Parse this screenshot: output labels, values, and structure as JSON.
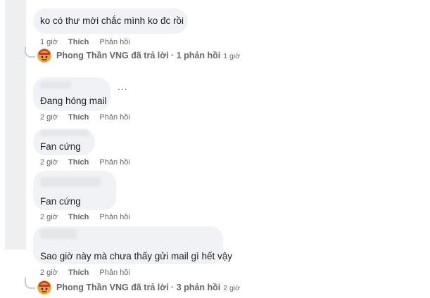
{
  "comments": [
    {
      "text": "ko có thư mời chắc mình ko đc rồi",
      "time": "1 giờ",
      "like": "Thích",
      "reply": "Phản hồi"
    },
    {
      "text": "Đang hóng mail",
      "time": "2 giờ",
      "like": "Thích",
      "reply": "Phản hồi",
      "more": "..."
    },
    {
      "text": "Fan cứng",
      "time": "2 giờ",
      "like": "Thích",
      "reply": "Phản hồi"
    },
    {
      "text": "Fan cứng",
      "time": "2 giờ",
      "like": "Thích",
      "reply": "Phản hồi"
    },
    {
      "text": "Sao giờ này mà chưa thấy gửi mail gì hết vậy",
      "time": "2 giờ",
      "like": "Thích",
      "reply": "Phản hồi"
    }
  ],
  "replies": [
    {
      "text": "Phong Thần VNG đã trả lời · 1 phản hồi",
      "time": "1 giờ"
    },
    {
      "text": "Phong Thần VNG đã trả lời · 3 phản hồi",
      "time": "2 giờ"
    }
  ]
}
